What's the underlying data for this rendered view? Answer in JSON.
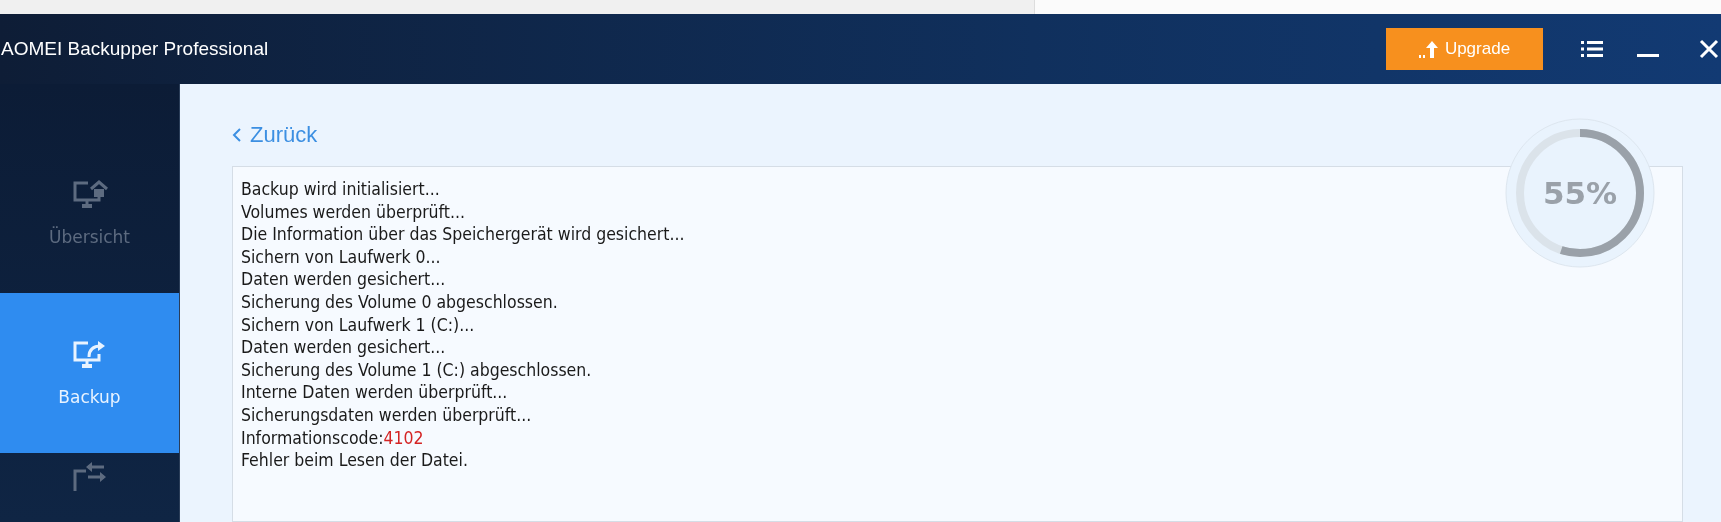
{
  "window": {
    "title": "AOMEI Backupper Professional",
    "upgrade_button": "Upgrade"
  },
  "sidebar": {
    "items": [
      {
        "kind": "home",
        "label": "Übersicht",
        "selected": false
      },
      {
        "kind": "backup",
        "label": "Backup",
        "selected": true
      },
      {
        "kind": "sync",
        "selected": false
      }
    ]
  },
  "back_link": "Zurück",
  "progress": {
    "level": 0.55,
    "reading": "55%"
  },
  "log": [
    {
      "text": "Backup wird initialisiert..."
    },
    {
      "text": "Volumes werden überprüft..."
    },
    {
      "text": "Die Information über das Speichergerät wird gesichert..."
    },
    {
      "text": "Sichern von Laufwerk 0..."
    },
    {
      "text": "Daten werden gesichert..."
    },
    {
      "text": "Sicherung des Volume 0 abgeschlossen."
    },
    {
      "text": "Sichern von Laufwerk 1 (C:)..."
    },
    {
      "text": "Daten werden gesichert..."
    },
    {
      "text": "Sicherung des Volume 1 (C:) abgeschlossen."
    },
    {
      "text": "Interne Daten werden überprüft..."
    },
    {
      "text": "Sicherungsdaten werden überprüft..."
    },
    {
      "text": "Informationscode:",
      "code": "4102"
    },
    {
      "text": "Fehler beim Lesen der Datei."
    }
  ]
}
